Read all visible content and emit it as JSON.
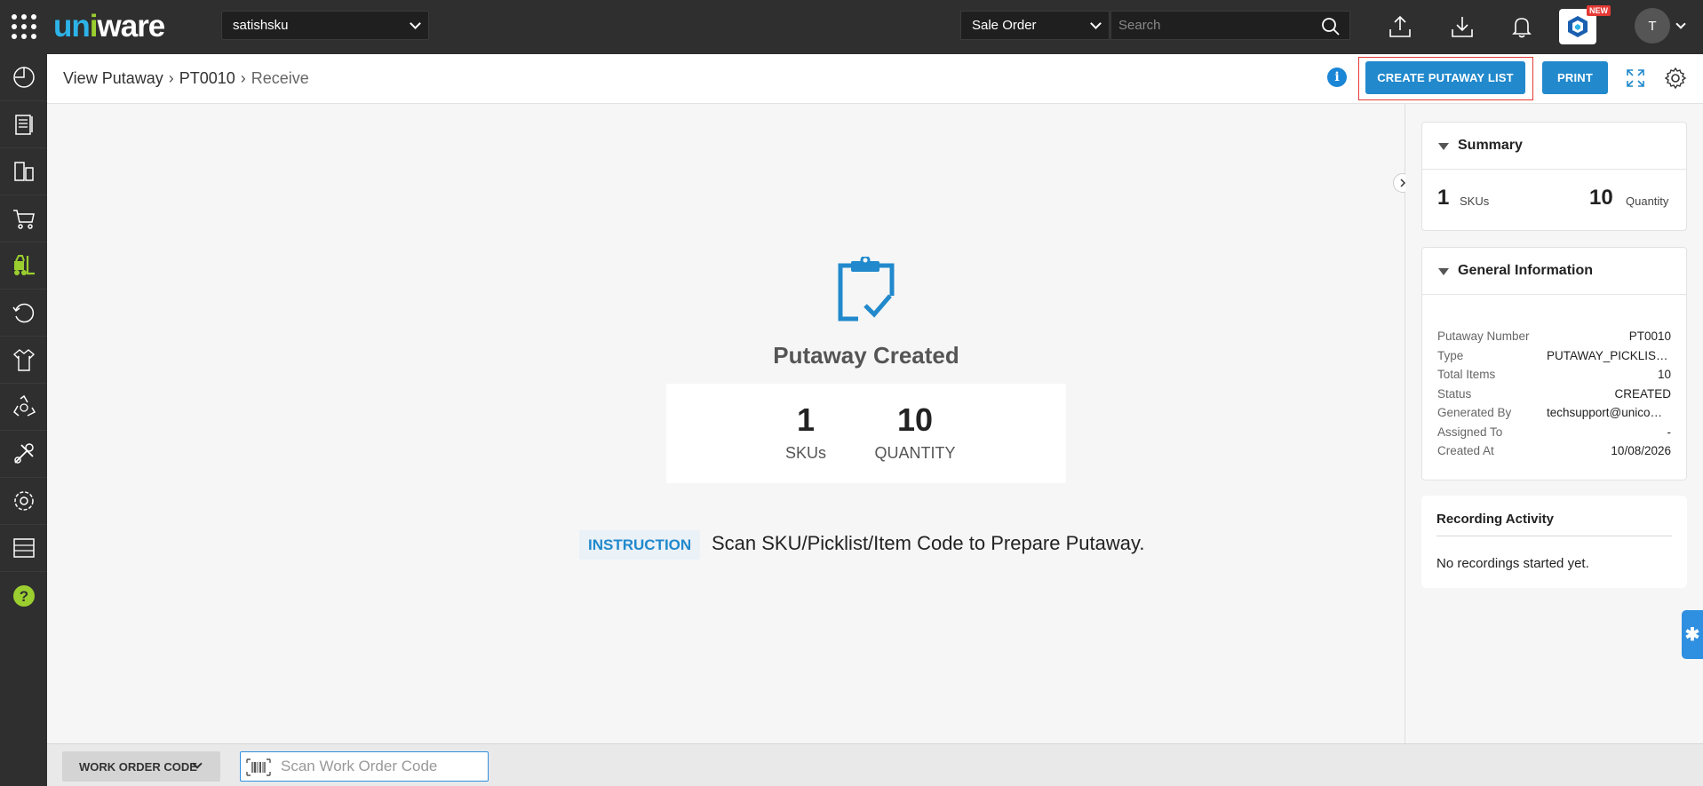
{
  "topbar": {
    "logo_part1": "un",
    "logo_part2": "i",
    "logo_part3": "ware",
    "tenant": "satishsku",
    "doc_type": "Sale Order",
    "search_placeholder": "Search",
    "new_badge": "NEW",
    "avatar_initial": "T"
  },
  "sidebar": {
    "items": [
      {
        "icon": "dashboard-icon"
      },
      {
        "icon": "orders-icon"
      },
      {
        "icon": "products-icon"
      },
      {
        "icon": "cart-icon"
      },
      {
        "icon": "forklift-icon",
        "active": true
      },
      {
        "icon": "returns-icon"
      },
      {
        "icon": "apparel-icon"
      },
      {
        "icon": "recycle-icon"
      },
      {
        "icon": "tools-icon"
      },
      {
        "icon": "settings-icon"
      },
      {
        "icon": "shelf-icon"
      },
      {
        "icon": "help-icon"
      }
    ]
  },
  "header": {
    "breadcrumb": [
      "View Putaway",
      "PT0010",
      "Receive"
    ],
    "create_btn": "CREATE PUTAWAY LIST",
    "print_btn": "PRINT"
  },
  "main": {
    "title": "Putaway Created",
    "skus_value": "1",
    "skus_label": "SKUs",
    "qty_value": "10",
    "qty_label": "QUANTITY",
    "instruction_tag": "INSTRUCTION",
    "instruction_text": "Scan SKU/Picklist/Item Code to Prepare Putaway."
  },
  "summary": {
    "title": "Summary",
    "skus_value": "1",
    "skus_label": "SKUs",
    "qty_value": "10",
    "qty_label": "Quantity"
  },
  "general_info": {
    "title": "General Information",
    "rows": [
      {
        "k": "Putaway Number",
        "v": "PT0010"
      },
      {
        "k": "Type",
        "v": "PUTAWAY_PICKLIST_ITEM"
      },
      {
        "k": "Total Items",
        "v": "10"
      },
      {
        "k": "Status",
        "v": "CREATED"
      },
      {
        "k": "Generated By",
        "v": "techsupport@unicommerce.com"
      },
      {
        "k": "Assigned To",
        "v": "-"
      },
      {
        "k": "Created At",
        "v": "10/08/2026"
      }
    ]
  },
  "recording": {
    "title": "Recording Activity",
    "empty": "No recordings started yet."
  },
  "bottom": {
    "mode": "WORK ORDER CODE",
    "input_placeholder": "Scan Work Order Code"
  },
  "colors": {
    "accent": "#2189cc",
    "topbar": "#2f2f2f",
    "highlight": "#e53935",
    "active_icon": "#9bcf2f"
  }
}
